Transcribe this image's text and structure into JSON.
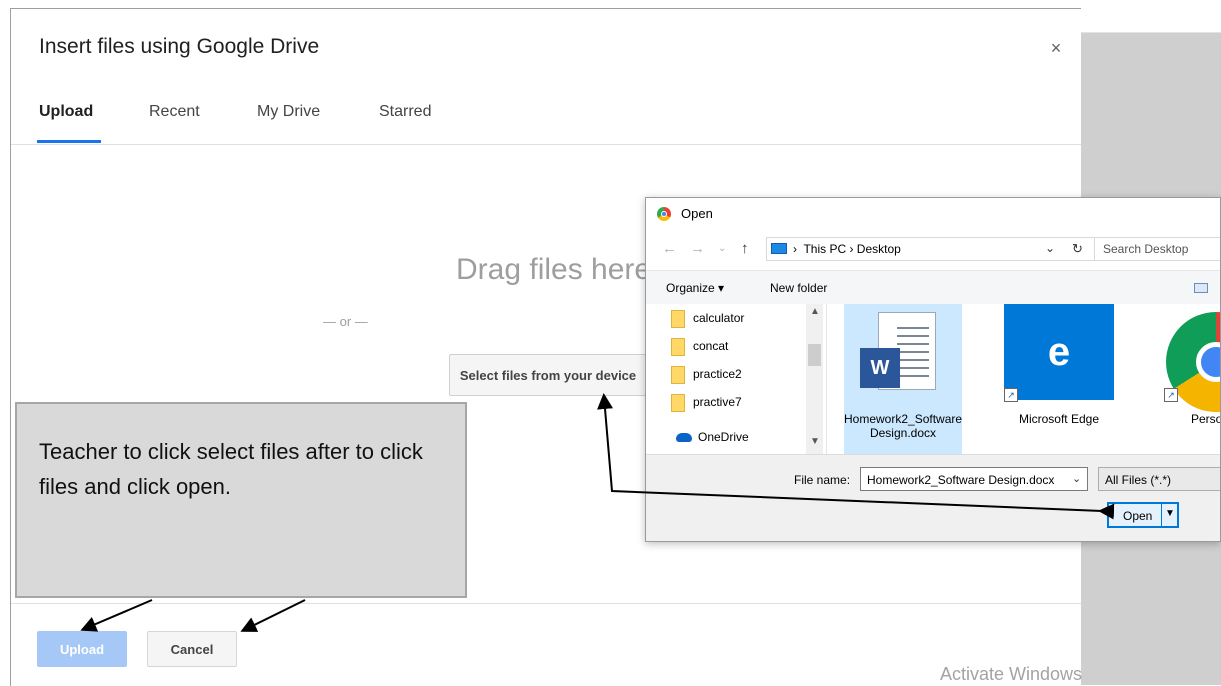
{
  "picker": {
    "title": "Insert files using Google Drive",
    "close_icon": "×",
    "tabs": [
      {
        "label": "Upload",
        "active": true
      },
      {
        "label": "Recent",
        "active": false
      },
      {
        "label": "My Drive",
        "active": false
      },
      {
        "label": "Starred",
        "active": false
      }
    ],
    "drag_text": "Drag files here",
    "or_text": "— or —",
    "select_button": "Select files from your device",
    "upload_button": "Upload",
    "cancel_button": "Cancel"
  },
  "callout": {
    "text": "Teacher to click select files after to click files and click open."
  },
  "open_dialog": {
    "title": "Open",
    "address": "This PC  ›  Desktop",
    "address_prefix": "›",
    "search_placeholder": "Search Desktop",
    "toolbar": {
      "organize": "Organize ▾",
      "new_folder": "New folder"
    },
    "nav_items": [
      {
        "label": "calculator",
        "icon": "folder-icon"
      },
      {
        "label": "concat",
        "icon": "folder-icon"
      },
      {
        "label": "practice2",
        "icon": "folder-icon"
      },
      {
        "label": "practive7",
        "icon": "folder-icon"
      },
      {
        "label": "OneDrive",
        "icon": "onedrive-icon"
      }
    ],
    "files": [
      {
        "label": "Homework2_Software Design.docx",
        "icon": "word-document-icon",
        "selected": true
      },
      {
        "label": "Microsoft Edge",
        "icon": "edge-icon",
        "selected": false
      },
      {
        "label": "Perso Chr",
        "icon": "chrome-icon",
        "selected": false
      }
    ],
    "file_name_label": "File name:",
    "file_name_value": "Homework2_Software Design.docx",
    "file_type": "All Files (*.*)",
    "open_button": "Open"
  },
  "watermark": "Activate Windows",
  "colors": {
    "accent": "#1a73e8",
    "upload_disabled": "#a6c8f6",
    "callout_bg": "#d9d9d9",
    "windows_blue": "#0078d7"
  }
}
